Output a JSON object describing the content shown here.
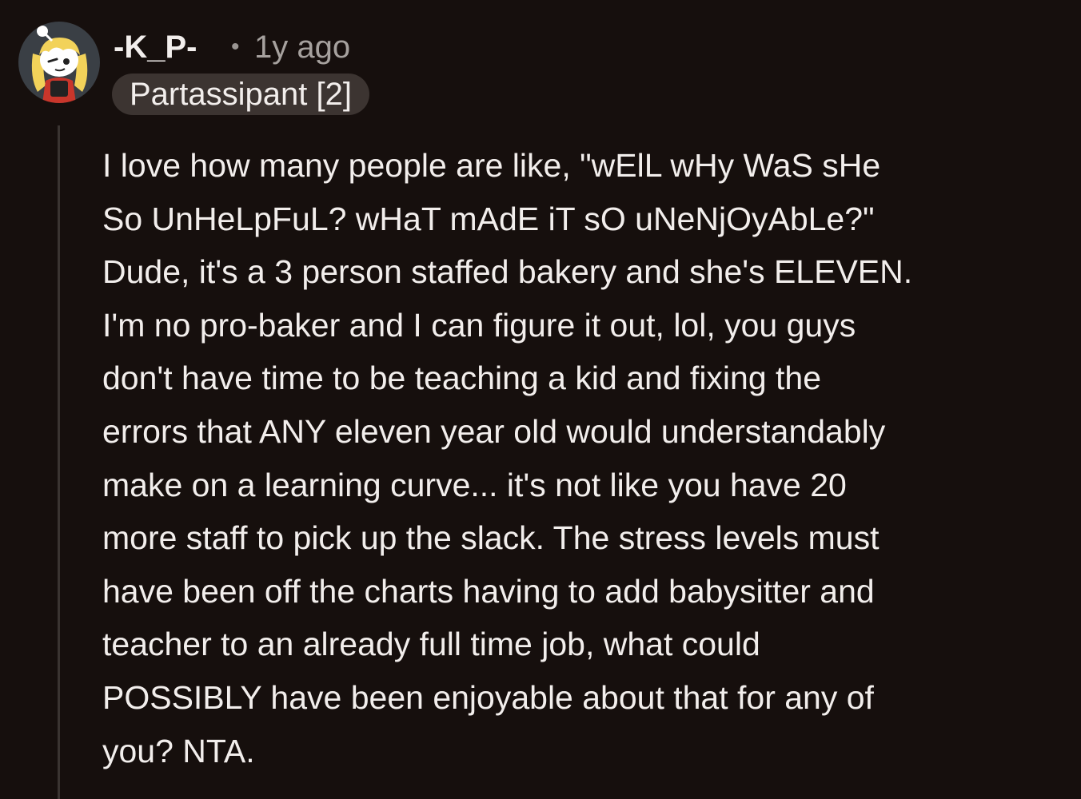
{
  "comment": {
    "author": {
      "username": "-K_P-",
      "avatar_icon": "snoo-avatar-icon",
      "flair": "Partassipant [2]"
    },
    "separator": "•",
    "timestamp": "1y ago",
    "body_lines": [
      "I love how many people are like, \"wElL wHy WaS sHe",
      "So UnHeLpFuL? wHaT mAdE iT sO uNeNjOyAbLe?\"",
      "Dude, it's a 3 person staffed bakery and she's ELEVEN.",
      "I'm no pro-baker and I can figure it out, lol, you guys",
      "don't have time to be teaching a kid and fixing the",
      "errors that ANY eleven year old would understandably",
      "make on a learning curve... it's not like you have 20",
      "more staff to pick up the slack. The stress levels must",
      "have been off the charts having to add babysitter and",
      "teacher to an already full time job, what could",
      "POSSIBLY have been enjoyable about that for any of",
      "you? NTA."
    ]
  },
  "colors": {
    "background": "#160f0d",
    "text": "#f2eeec",
    "muted_text": "#a6a19e",
    "flair_background": "#3c3431",
    "thread_line": "#3a3431"
  }
}
